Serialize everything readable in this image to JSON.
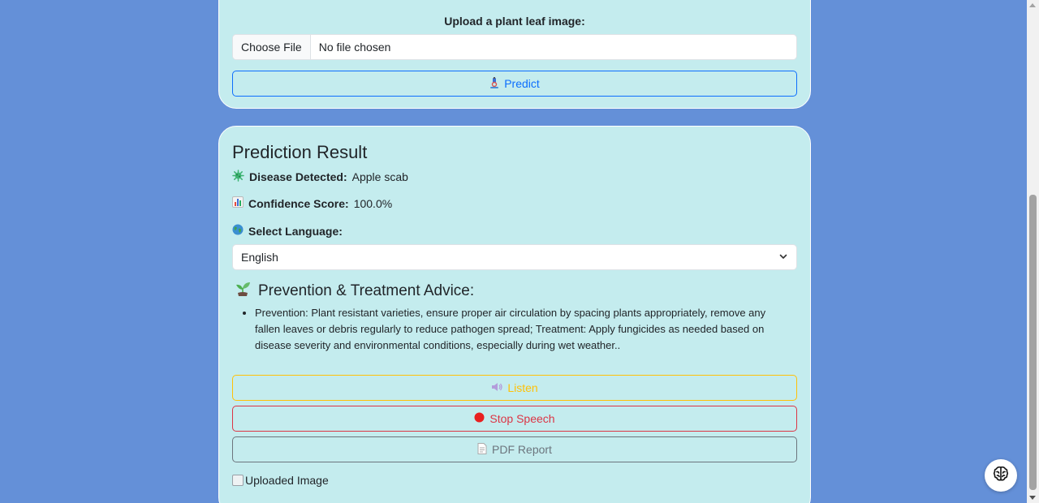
{
  "upload": {
    "label": "Upload a plant leaf image:",
    "choose_file_label": "Choose File",
    "file_status": "No file chosen",
    "predict_label": "Predict",
    "predict_icon": "microscope-icon"
  },
  "result": {
    "title": "Prediction Result",
    "disease_label": "Disease Detected:",
    "disease_value": "Apple scab",
    "disease_icon": "microbe-icon",
    "confidence_label": "Confidence Score:",
    "confidence_value": "100.0%",
    "confidence_icon": "bar-chart-icon",
    "language_label": "Select Language:",
    "language_icon": "globe-icon",
    "language_selected": "English",
    "advice_title": "Prevention & Treatment Advice:",
    "advice_icon": "seedling-icon",
    "advice_items": [
      "Prevention: Plant resistant varieties, ensure proper air circulation by spacing plants appropriately, remove any fallen leaves or debris regularly to reduce pathogen spread; Treatment: Apply fungicides as needed based on disease severity and environmental conditions, especially during wet weather.."
    ],
    "listen_label": "Listen",
    "listen_icon": "speaker-icon",
    "stop_label": "Stop Speech",
    "stop_icon": "red-circle-icon",
    "pdf_label": "PDF Report",
    "pdf_icon": "document-icon",
    "uploaded_image_alt": "Uploaded Image"
  },
  "colors": {
    "page_background": "#6490d8",
    "card_background": "#c4ecee",
    "primary": "#0d6efd",
    "warning": "#ffc107",
    "danger": "#dc3545",
    "secondary": "#6c757d"
  },
  "chat_widget": {
    "icon": "brain-icon"
  }
}
